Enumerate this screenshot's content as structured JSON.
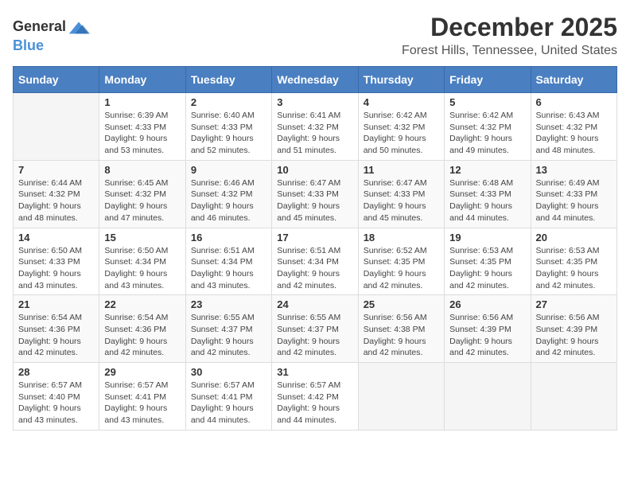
{
  "header": {
    "logo_general": "General",
    "logo_blue": "Blue",
    "month_title": "December 2025",
    "location": "Forest Hills, Tennessee, United States"
  },
  "columns": [
    "Sunday",
    "Monday",
    "Tuesday",
    "Wednesday",
    "Thursday",
    "Friday",
    "Saturday"
  ],
  "weeks": [
    [
      {
        "day": "",
        "sunrise": "",
        "sunset": "",
        "daylight": ""
      },
      {
        "day": "1",
        "sunrise": "Sunrise: 6:39 AM",
        "sunset": "Sunset: 4:33 PM",
        "daylight": "Daylight: 9 hours and 53 minutes."
      },
      {
        "day": "2",
        "sunrise": "Sunrise: 6:40 AM",
        "sunset": "Sunset: 4:33 PM",
        "daylight": "Daylight: 9 hours and 52 minutes."
      },
      {
        "day": "3",
        "sunrise": "Sunrise: 6:41 AM",
        "sunset": "Sunset: 4:32 PM",
        "daylight": "Daylight: 9 hours and 51 minutes."
      },
      {
        "day": "4",
        "sunrise": "Sunrise: 6:42 AM",
        "sunset": "Sunset: 4:32 PM",
        "daylight": "Daylight: 9 hours and 50 minutes."
      },
      {
        "day": "5",
        "sunrise": "Sunrise: 6:42 AM",
        "sunset": "Sunset: 4:32 PM",
        "daylight": "Daylight: 9 hours and 49 minutes."
      },
      {
        "day": "6",
        "sunrise": "Sunrise: 6:43 AM",
        "sunset": "Sunset: 4:32 PM",
        "daylight": "Daylight: 9 hours and 48 minutes."
      }
    ],
    [
      {
        "day": "7",
        "sunrise": "Sunrise: 6:44 AM",
        "sunset": "Sunset: 4:32 PM",
        "daylight": "Daylight: 9 hours and 48 minutes."
      },
      {
        "day": "8",
        "sunrise": "Sunrise: 6:45 AM",
        "sunset": "Sunset: 4:32 PM",
        "daylight": "Daylight: 9 hours and 47 minutes."
      },
      {
        "day": "9",
        "sunrise": "Sunrise: 6:46 AM",
        "sunset": "Sunset: 4:32 PM",
        "daylight": "Daylight: 9 hours and 46 minutes."
      },
      {
        "day": "10",
        "sunrise": "Sunrise: 6:47 AM",
        "sunset": "Sunset: 4:33 PM",
        "daylight": "Daylight: 9 hours and 45 minutes."
      },
      {
        "day": "11",
        "sunrise": "Sunrise: 6:47 AM",
        "sunset": "Sunset: 4:33 PM",
        "daylight": "Daylight: 9 hours and 45 minutes."
      },
      {
        "day": "12",
        "sunrise": "Sunrise: 6:48 AM",
        "sunset": "Sunset: 4:33 PM",
        "daylight": "Daylight: 9 hours and 44 minutes."
      },
      {
        "day": "13",
        "sunrise": "Sunrise: 6:49 AM",
        "sunset": "Sunset: 4:33 PM",
        "daylight": "Daylight: 9 hours and 44 minutes."
      }
    ],
    [
      {
        "day": "14",
        "sunrise": "Sunrise: 6:50 AM",
        "sunset": "Sunset: 4:33 PM",
        "daylight": "Daylight: 9 hours and 43 minutes."
      },
      {
        "day": "15",
        "sunrise": "Sunrise: 6:50 AM",
        "sunset": "Sunset: 4:34 PM",
        "daylight": "Daylight: 9 hours and 43 minutes."
      },
      {
        "day": "16",
        "sunrise": "Sunrise: 6:51 AM",
        "sunset": "Sunset: 4:34 PM",
        "daylight": "Daylight: 9 hours and 43 minutes."
      },
      {
        "day": "17",
        "sunrise": "Sunrise: 6:51 AM",
        "sunset": "Sunset: 4:34 PM",
        "daylight": "Daylight: 9 hours and 42 minutes."
      },
      {
        "day": "18",
        "sunrise": "Sunrise: 6:52 AM",
        "sunset": "Sunset: 4:35 PM",
        "daylight": "Daylight: 9 hours and 42 minutes."
      },
      {
        "day": "19",
        "sunrise": "Sunrise: 6:53 AM",
        "sunset": "Sunset: 4:35 PM",
        "daylight": "Daylight: 9 hours and 42 minutes."
      },
      {
        "day": "20",
        "sunrise": "Sunrise: 6:53 AM",
        "sunset": "Sunset: 4:35 PM",
        "daylight": "Daylight: 9 hours and 42 minutes."
      }
    ],
    [
      {
        "day": "21",
        "sunrise": "Sunrise: 6:54 AM",
        "sunset": "Sunset: 4:36 PM",
        "daylight": "Daylight: 9 hours and 42 minutes."
      },
      {
        "day": "22",
        "sunrise": "Sunrise: 6:54 AM",
        "sunset": "Sunset: 4:36 PM",
        "daylight": "Daylight: 9 hours and 42 minutes."
      },
      {
        "day": "23",
        "sunrise": "Sunrise: 6:55 AM",
        "sunset": "Sunset: 4:37 PM",
        "daylight": "Daylight: 9 hours and 42 minutes."
      },
      {
        "day": "24",
        "sunrise": "Sunrise: 6:55 AM",
        "sunset": "Sunset: 4:37 PM",
        "daylight": "Daylight: 9 hours and 42 minutes."
      },
      {
        "day": "25",
        "sunrise": "Sunrise: 6:56 AM",
        "sunset": "Sunset: 4:38 PM",
        "daylight": "Daylight: 9 hours and 42 minutes."
      },
      {
        "day": "26",
        "sunrise": "Sunrise: 6:56 AM",
        "sunset": "Sunset: 4:39 PM",
        "daylight": "Daylight: 9 hours and 42 minutes."
      },
      {
        "day": "27",
        "sunrise": "Sunrise: 6:56 AM",
        "sunset": "Sunset: 4:39 PM",
        "daylight": "Daylight: 9 hours and 42 minutes."
      }
    ],
    [
      {
        "day": "28",
        "sunrise": "Sunrise: 6:57 AM",
        "sunset": "Sunset: 4:40 PM",
        "daylight": "Daylight: 9 hours and 43 minutes."
      },
      {
        "day": "29",
        "sunrise": "Sunrise: 6:57 AM",
        "sunset": "Sunset: 4:41 PM",
        "daylight": "Daylight: 9 hours and 43 minutes."
      },
      {
        "day": "30",
        "sunrise": "Sunrise: 6:57 AM",
        "sunset": "Sunset: 4:41 PM",
        "daylight": "Daylight: 9 hours and 44 minutes."
      },
      {
        "day": "31",
        "sunrise": "Sunrise: 6:57 AM",
        "sunset": "Sunset: 4:42 PM",
        "daylight": "Daylight: 9 hours and 44 minutes."
      },
      {
        "day": "",
        "sunrise": "",
        "sunset": "",
        "daylight": ""
      },
      {
        "day": "",
        "sunrise": "",
        "sunset": "",
        "daylight": ""
      },
      {
        "day": "",
        "sunrise": "",
        "sunset": "",
        "daylight": ""
      }
    ]
  ]
}
